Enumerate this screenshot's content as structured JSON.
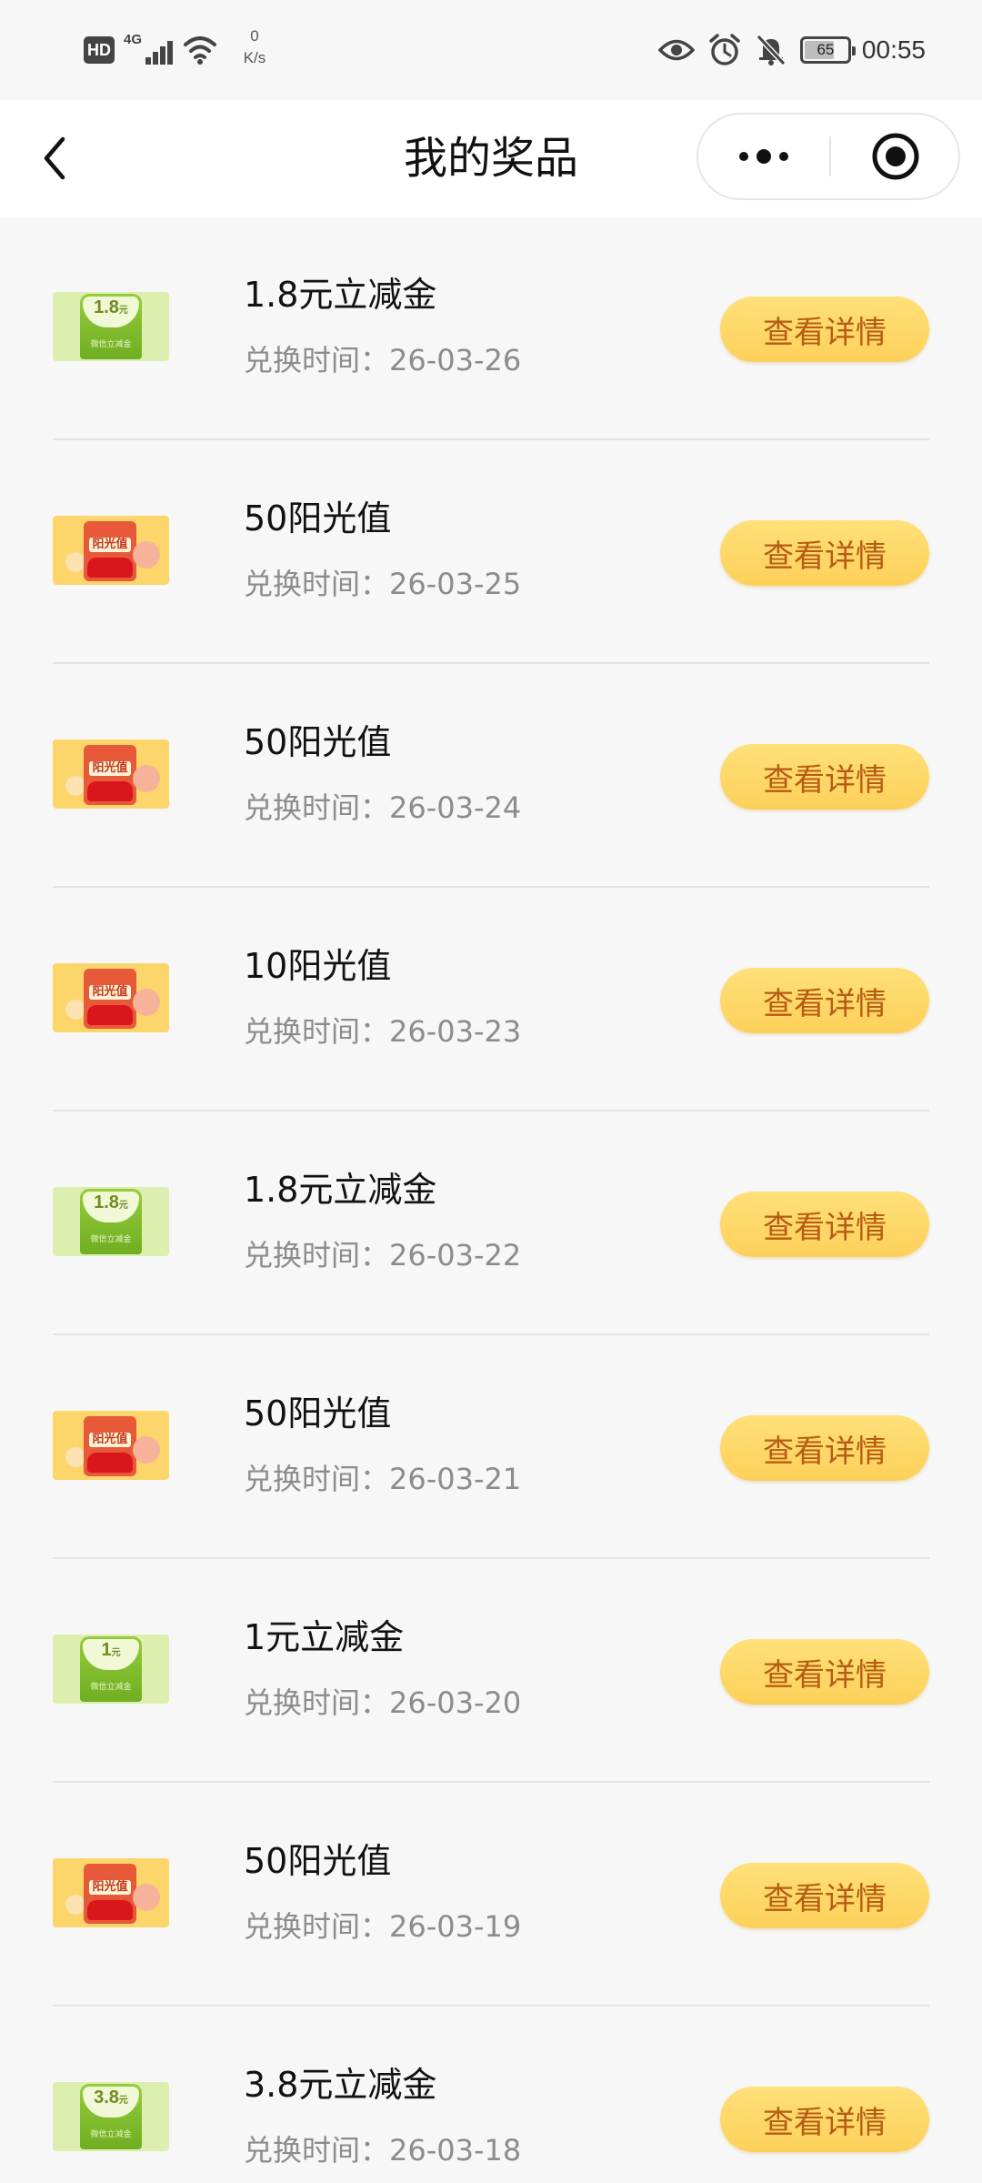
{
  "status_bar": {
    "hd": "HD",
    "network": "4G",
    "speed_value": "0",
    "speed_unit": "K/s",
    "battery": "65",
    "time": "00:55"
  },
  "header": {
    "title": "我的奖品"
  },
  "prizes": [
    {
      "type": "coupon",
      "thumb_amount": "1.8",
      "thumb_unit": "元",
      "thumb_sub": "微信立减金",
      "name": "1.8元立减金",
      "time": "兑换时间：26-03-26",
      "button": "查看详情"
    },
    {
      "type": "sun",
      "thumb_label": "阳光值",
      "name": "50阳光值",
      "time": "兑换时间：26-03-25",
      "button": "查看详情"
    },
    {
      "type": "sun",
      "thumb_label": "阳光值",
      "name": "50阳光值",
      "time": "兑换时间：26-03-24",
      "button": "查看详情"
    },
    {
      "type": "sun",
      "thumb_label": "阳光值",
      "name": "10阳光值",
      "time": "兑换时间：26-03-23",
      "button": "查看详情"
    },
    {
      "type": "coupon",
      "thumb_amount": "1.8",
      "thumb_unit": "元",
      "thumb_sub": "微信立减金",
      "name": "1.8元立减金",
      "time": "兑换时间：26-03-22",
      "button": "查看详情"
    },
    {
      "type": "sun",
      "thumb_label": "阳光值",
      "name": "50阳光值",
      "time": "兑换时间：26-03-21",
      "button": "查看详情"
    },
    {
      "type": "coupon",
      "thumb_amount": "1",
      "thumb_unit": "元",
      "thumb_sub": "微信立减金",
      "name": "1元立减金",
      "time": "兑换时间：26-03-20",
      "button": "查看详情"
    },
    {
      "type": "sun",
      "thumb_label": "阳光值",
      "name": "50阳光值",
      "time": "兑换时间：26-03-19",
      "button": "查看详情"
    },
    {
      "type": "coupon",
      "thumb_amount": "3.8",
      "thumb_unit": "元",
      "thumb_sub": "微信立减金",
      "name": "3.8元立减金",
      "time": "兑换时间：26-03-18",
      "button": "查看详情"
    }
  ]
}
